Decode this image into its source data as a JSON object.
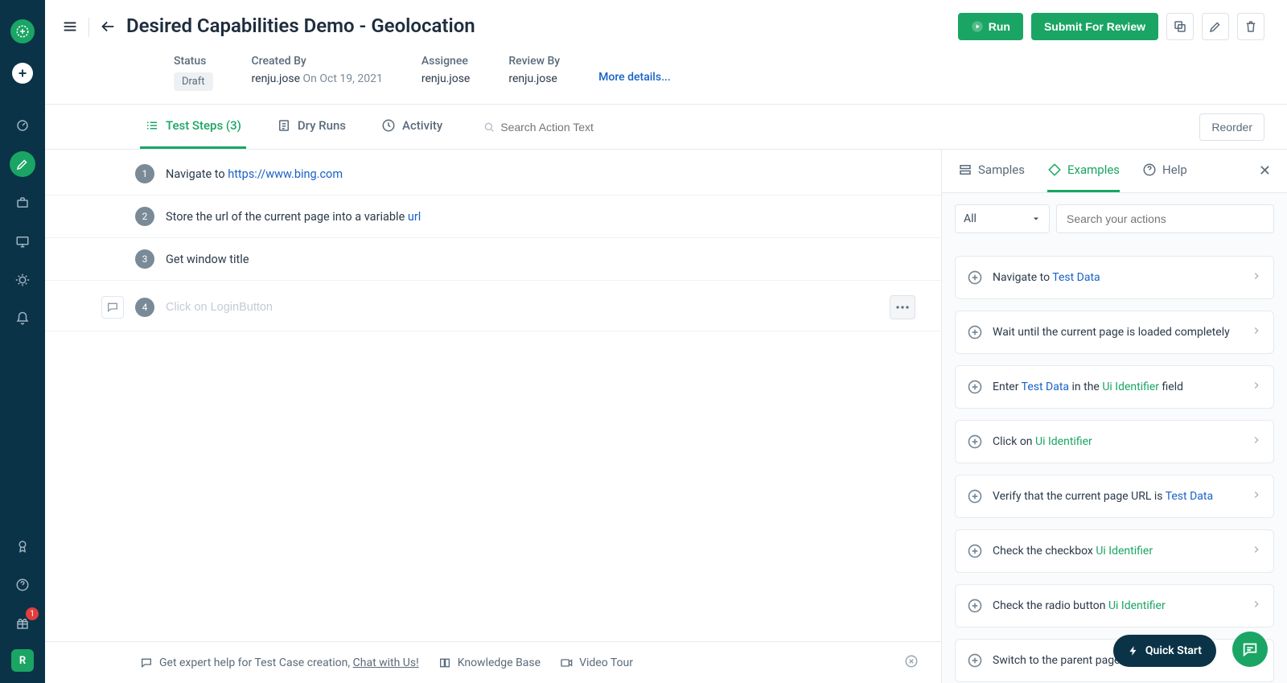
{
  "sidebar": {
    "badge_count": "1",
    "avatar_initial": "R"
  },
  "header": {
    "title": "Desired Capabilities Demo - Geolocation",
    "run_label": "Run",
    "submit_label": "Submit For Review"
  },
  "meta": {
    "status_label": "Status",
    "status_value": "Draft",
    "created_by_label": "Created By",
    "created_by_value": "renju.jose",
    "created_at": "On Oct 19, 2021",
    "assignee_label": "Assignee",
    "assignee_value": "renju.jose",
    "review_by_label": "Review By",
    "review_by_value": "renju.jose",
    "more_details": "More details..."
  },
  "tabs": {
    "test_steps": "Test Steps (3)",
    "dry_runs": "Dry Runs",
    "activity": "Activity",
    "search_placeholder": "Search Action Text",
    "reorder": "Reorder"
  },
  "steps": [
    {
      "num": "1",
      "pre": "Navigate to ",
      "link": "https://www.bing.com",
      "post": ""
    },
    {
      "num": "2",
      "pre": "Store the url of the current page into a variable ",
      "var": "url",
      "post": ""
    },
    {
      "num": "3",
      "pre": "Get window title",
      "link": "",
      "post": ""
    }
  ],
  "new_step": {
    "num": "4",
    "placeholder": "Click on LoginButton"
  },
  "right_panel": {
    "tabs": {
      "samples": "Samples",
      "examples": "Examples",
      "help": "Help"
    },
    "filter_value": "All",
    "search_placeholder": "Search your actions",
    "examples": [
      {
        "parts": [
          {
            "t": "Navigate to "
          },
          {
            "t": "Test Data",
            "cls": "td"
          }
        ]
      },
      {
        "parts": [
          {
            "t": "Wait until the current page is loaded completely"
          }
        ]
      },
      {
        "parts": [
          {
            "t": "Enter "
          },
          {
            "t": "Test Data",
            "cls": "td"
          },
          {
            "t": " in the "
          },
          {
            "t": "Ui Identifier",
            "cls": "ui"
          },
          {
            "t": " field"
          }
        ]
      },
      {
        "parts": [
          {
            "t": "Click on "
          },
          {
            "t": "Ui Identifier",
            "cls": "ui"
          }
        ]
      },
      {
        "parts": [
          {
            "t": "Verify that the current page URL is "
          },
          {
            "t": "Test Data",
            "cls": "td"
          }
        ]
      },
      {
        "parts": [
          {
            "t": "Check the checkbox "
          },
          {
            "t": "Ui Identifier",
            "cls": "ui"
          }
        ]
      },
      {
        "parts": [
          {
            "t": "Check the radio button "
          },
          {
            "t": "Ui Identifier",
            "cls": "ui"
          }
        ]
      },
      {
        "parts": [
          {
            "t": "Switch to the parent page"
          }
        ]
      }
    ]
  },
  "footer": {
    "help_prefix": "Get expert help for Test Case creation, ",
    "chat_link": "Chat with Us!",
    "kb": "Knowledge Base",
    "video": "Video Tour"
  },
  "quick_start": "Quick Start"
}
